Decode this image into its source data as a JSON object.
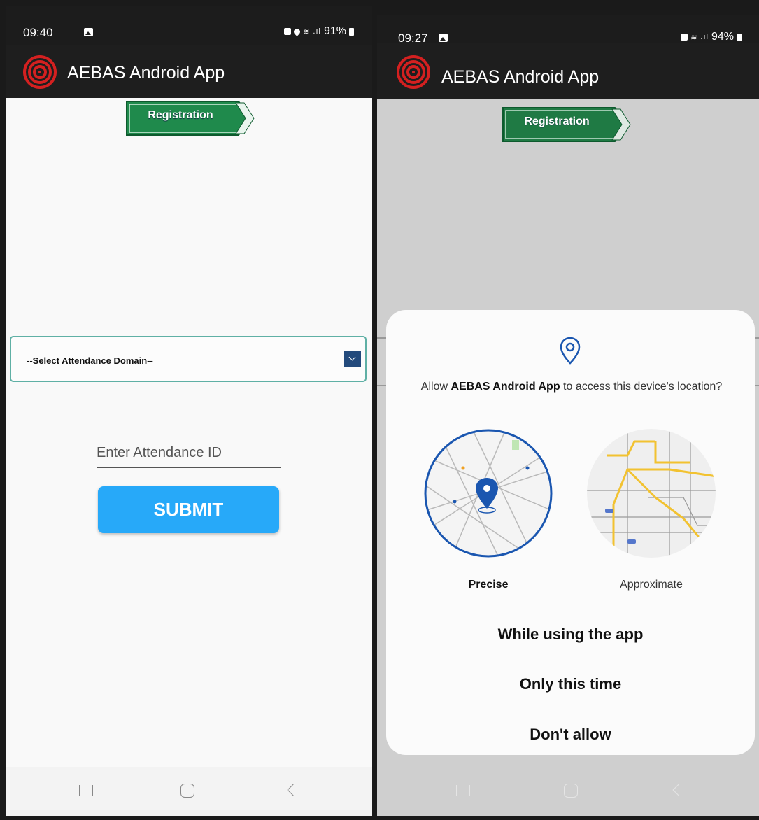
{
  "left": {
    "status": {
      "time": "09:40",
      "battery": "91%"
    },
    "appbar": {
      "title": "AEBAS Android App"
    },
    "registration_label": "Registration",
    "domain_select": {
      "selected": "--Select Attendance Domain--"
    },
    "attendance_input": {
      "placeholder": "Enter Attendance ID",
      "value": ""
    },
    "submit_label": "SUBMIT"
  },
  "right": {
    "status": {
      "time": "09:27",
      "battery": "94%"
    },
    "appbar": {
      "title": "AEBAS Android App"
    },
    "registration_label": "Registration",
    "dialog": {
      "message_prefix": "Allow ",
      "app_name": "AEBAS Android App",
      "message_suffix": " to access this device's location?",
      "option_precise": "Precise",
      "option_approximate": "Approximate",
      "choice_while_using": "While using the app",
      "choice_only_this_time": "Only this time",
      "choice_dont_allow": "Don't allow"
    }
  },
  "colors": {
    "submit": "#27a9f9",
    "registration": "#1f8a4c",
    "logo": "#d42020",
    "select_border": "#5fb0a5",
    "dropdown_arrow_bg": "#234a7c",
    "pin": "#1a56b0"
  }
}
